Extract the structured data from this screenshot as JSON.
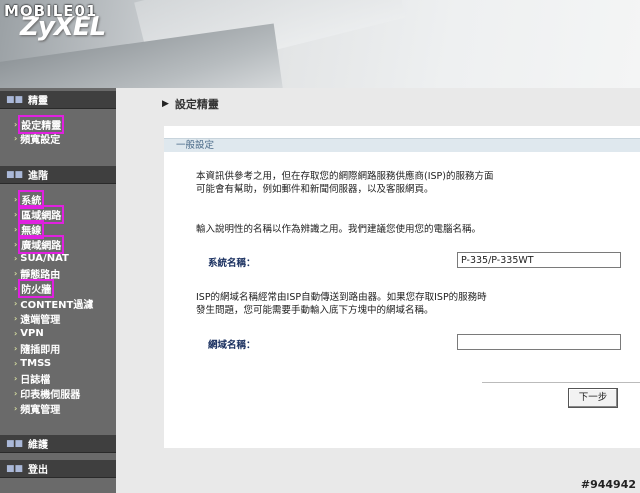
{
  "watermark": "MOBILE01",
  "brand": "ZyXEL",
  "sidebar": {
    "sections": [
      {
        "label": "精靈",
        "items": [
          {
            "label": "設定精靈",
            "highlighted": true
          },
          {
            "label": "頻寬設定",
            "highlighted": false
          }
        ]
      },
      {
        "label": "進階",
        "items": [
          {
            "label": "系統",
            "highlighted": true
          },
          {
            "label": "區域網路",
            "highlighted": true
          },
          {
            "label": "無線",
            "highlighted": true
          },
          {
            "label": "廣域網路",
            "highlighted": true
          },
          {
            "label": "SUA/NAT",
            "highlighted": false
          },
          {
            "label": "靜態路由",
            "highlighted": false
          },
          {
            "label": "防火牆",
            "highlighted": true
          },
          {
            "label": "CONTENT過濾",
            "highlighted": false
          },
          {
            "label": "遠端管理",
            "highlighted": false
          },
          {
            "label": "VPN",
            "highlighted": false
          },
          {
            "label": "隨插即用",
            "highlighted": false
          },
          {
            "label": "TMSS",
            "highlighted": false
          },
          {
            "label": "日誌檔",
            "highlighted": false
          },
          {
            "label": "印表機伺服器",
            "highlighted": false
          },
          {
            "label": "頻寬管理",
            "highlighted": false
          }
        ]
      },
      {
        "label": "維護",
        "items": []
      },
      {
        "label": "登出",
        "items": []
      }
    ]
  },
  "main": {
    "title": "設定精靈",
    "section_header": "一般設定",
    "para1": "本資訊供參考之用，但在存取您的網際網路服務供應商(ISP)的服務方面可能會有幫助，例如郵件和新聞伺服器，以及客服網頁。",
    "para2": "輸入說明性的名稱以作為辨識之用。我們建議您使用您的電腦名稱。",
    "system_name_label": "系統名稱：",
    "system_name_value": "P-335/P-335WT",
    "para3": "ISP的網域名稱經常由ISP自動傳送到路由器。如果您存取ISP的服務時發生問題，您可能需要手動輸入底下方塊中的網域名稱。",
    "domain_name_label": "網域名稱：",
    "domain_name_value": "",
    "next_button": "下一步"
  },
  "badge": "#944942",
  "colors": {
    "highlight": "#e020e0",
    "sidebar_bg": "#6a6a6a",
    "section_bg": "#3f3f3f"
  }
}
